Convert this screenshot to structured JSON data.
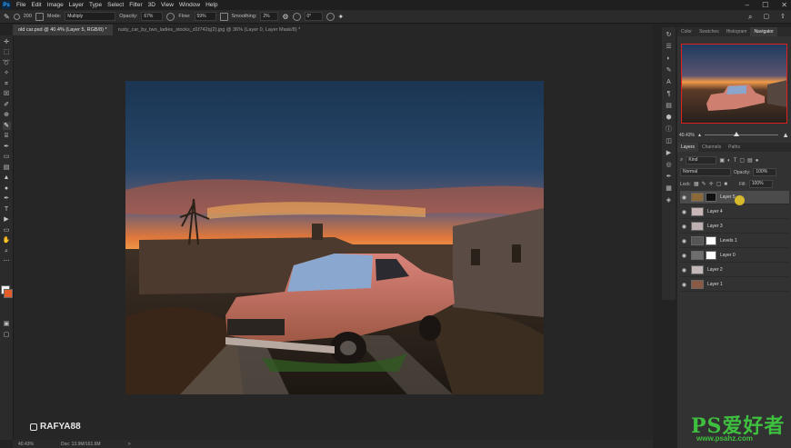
{
  "app": {
    "logo": "Ps"
  },
  "menu": [
    "File",
    "Edit",
    "Image",
    "Layer",
    "Type",
    "Select",
    "Filter",
    "3D",
    "View",
    "Window",
    "Help"
  ],
  "window_controls": [
    "–",
    "☐",
    "✕"
  ],
  "options_bar": {
    "brush_size": "200",
    "mode_label": "Mode:",
    "mode_value": "Multiply",
    "opacity_label": "Opacity:",
    "opacity_value": "67%",
    "flow_label": "Flow:",
    "flow_value": "59%",
    "smoothing_label": "Smoothing:",
    "smoothing_value": "2%",
    "angle_value": "0°"
  },
  "tabs": [
    {
      "label": "old car.psd @ 40.4% (Layer 5, RGB/8) *",
      "active": true
    },
    {
      "label": "rusty_car_by_two_ladies_stocks_d1f742q(2).jpg @ 36% (Layer 0, Layer Mask/8) *",
      "active": false
    }
  ],
  "status": {
    "zoom": "40.43%",
    "doc": "Doc: 13.9M/161.6M",
    "arrow": ">"
  },
  "watermark": {
    "handle": "RAFYA88"
  },
  "panel": {
    "top_tabs": [
      "Color",
      "Swatches",
      "Histogram",
      "Navigator"
    ],
    "zoom": "40.43%",
    "layer_tabs": [
      "Layers",
      "Channels",
      "Paths"
    ],
    "filter_kind": "Kind",
    "blend_mode": "Normal",
    "opacity_label": "Opacity:",
    "opacity_value": "100%",
    "lock_label": "Lock:",
    "fill_label": "Fill:",
    "fill_value": "100%",
    "layers": [
      {
        "name": "Layer 5",
        "selected": true,
        "has_mask": true,
        "thumb": "#8b6a3a"
      },
      {
        "name": "Layer 4",
        "selected": false,
        "has_mask": false,
        "thumb": "#c9b6b6"
      },
      {
        "name": "Layer 3",
        "selected": false,
        "has_mask": false,
        "thumb": "#bfb1b1"
      },
      {
        "name": "Levels 1",
        "selected": false,
        "has_mask": true,
        "thumb": "#555555"
      },
      {
        "name": "Layer 0",
        "selected": false,
        "has_mask": true,
        "thumb": "#6e6e6e"
      },
      {
        "name": "Layer 2",
        "selected": false,
        "has_mask": false,
        "thumb": "#c4b8b8"
      },
      {
        "name": "Layer 1",
        "selected": false,
        "has_mask": false,
        "thumb": "#8a5a45"
      }
    ]
  },
  "site_watermark": {
    "logo": "PS爱好者",
    "url": "www.psahz.com"
  },
  "colors": {
    "accent": "#31a8ff",
    "selection": "#e0201e",
    "cursor": "#f0cd28"
  }
}
